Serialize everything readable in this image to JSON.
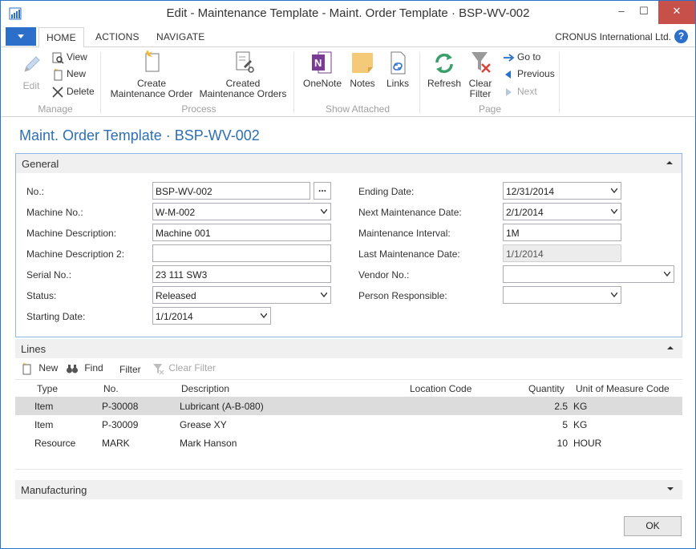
{
  "window": {
    "title": "Edit - Maintenance Template - Maint. Order Template · BSP-WV-002",
    "minimize_label": "–",
    "maximize_label": "☐",
    "close_label": "✕"
  },
  "tabs": {
    "home": "HOME",
    "actions": "ACTIONS",
    "navigate": "NAVIGATE"
  },
  "company": "CRONUS International Ltd.",
  "help_label": "?",
  "ribbon": {
    "manage": {
      "label": "Manage",
      "edit": "Edit",
      "view": "View",
      "new": "New",
      "delete": "Delete"
    },
    "process": {
      "label": "Process",
      "create_line1": "Create",
      "create_line2": "Maintenance Order",
      "created_line1": "Created",
      "created_line2": "Maintenance Orders"
    },
    "show_attached": {
      "label": "Show Attached",
      "onenote": "OneNote",
      "notes": "Notes",
      "links": "Links"
    },
    "page": {
      "label": "Page",
      "refresh": "Refresh",
      "clear_line1": "Clear",
      "clear_line2": "Filter",
      "goto": "Go to",
      "previous": "Previous",
      "next": "Next"
    }
  },
  "page_title": "Maint. Order Template · BSP-WV-002",
  "general": {
    "header": "General",
    "left": [
      {
        "label": "No.:",
        "value": "BSP-WV-002"
      },
      {
        "label": "Machine No.:",
        "value": "W-M-002"
      },
      {
        "label": "Machine Description:",
        "value": "Machine 001"
      },
      {
        "label": "Machine Description 2:",
        "value": ""
      },
      {
        "label": "Serial No.:",
        "value": "23 111 SW3"
      },
      {
        "label": "Status:",
        "value": "Released"
      },
      {
        "label": "Starting Date:",
        "value": "1/1/2014"
      }
    ],
    "right": [
      {
        "label": "Ending Date:",
        "value": "12/31/2014"
      },
      {
        "label": "Next Maintenance Date:",
        "value": "2/1/2014"
      },
      {
        "label": "Maintenance Interval:",
        "value": "1M"
      },
      {
        "label": "Last Maintenance Date:",
        "value": "1/1/2014"
      },
      {
        "label": "Vendor No.:",
        "value": ""
      },
      {
        "label": "Person Responsible:",
        "value": ""
      }
    ],
    "assist_label": "..."
  },
  "lines": {
    "header": "Lines",
    "toolbar": {
      "new": "New",
      "find": "Find",
      "filter": "Filter",
      "clear_filter": "Clear Filter"
    },
    "columns": [
      "Type",
      "No.",
      "Description",
      "Location Code",
      "Quantity",
      "Unit of Measure Code"
    ],
    "rows": [
      {
        "type": "Item",
        "no": "P-30008",
        "description": "Lubricant (A-B-080)",
        "location": "",
        "quantity": "2.5",
        "uom": "KG"
      },
      {
        "type": "Item",
        "no": "P-30009",
        "description": "Grease XY",
        "location": "",
        "quantity": "5",
        "uom": "KG"
      },
      {
        "type": "Resource",
        "no": "MARK",
        "description": "Mark Hanson",
        "location": "",
        "quantity": "10",
        "uom": "HOUR"
      }
    ]
  },
  "manufacturing": {
    "header": "Manufacturing"
  },
  "ok_label": "OK",
  "colors": {
    "accent": "#2b6fcb",
    "title_blue": "#2f6fb3",
    "close_red": "#c7504b",
    "selected_row": "#dcdcdc",
    "fasttab_bg": "#f0f0f0"
  }
}
